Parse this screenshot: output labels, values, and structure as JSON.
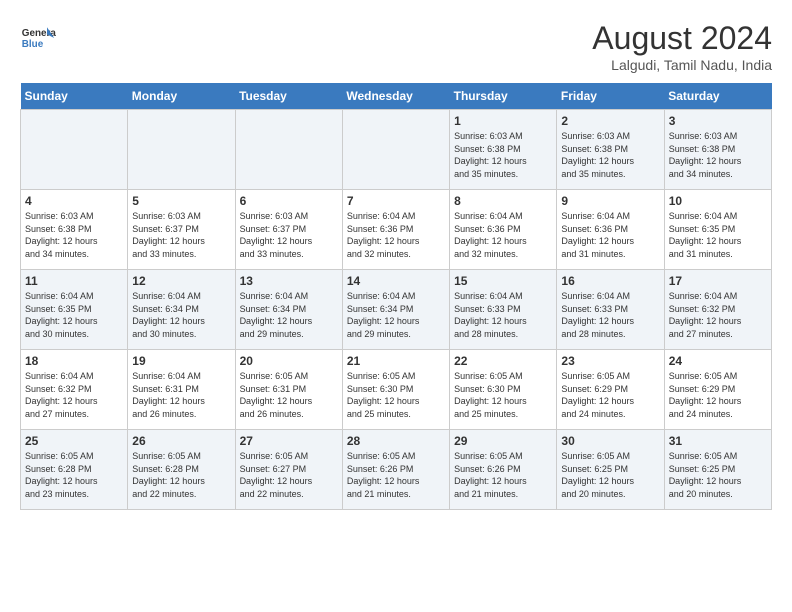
{
  "header": {
    "logo_line1": "General",
    "logo_line2": "Blue",
    "month_year": "August 2024",
    "location": "Lalgudi, Tamil Nadu, India"
  },
  "weekdays": [
    "Sunday",
    "Monday",
    "Tuesday",
    "Wednesday",
    "Thursday",
    "Friday",
    "Saturday"
  ],
  "weeks": [
    [
      {
        "day": "",
        "info": ""
      },
      {
        "day": "",
        "info": ""
      },
      {
        "day": "",
        "info": ""
      },
      {
        "day": "",
        "info": ""
      },
      {
        "day": "1",
        "info": "Sunrise: 6:03 AM\nSunset: 6:38 PM\nDaylight: 12 hours\nand 35 minutes."
      },
      {
        "day": "2",
        "info": "Sunrise: 6:03 AM\nSunset: 6:38 PM\nDaylight: 12 hours\nand 35 minutes."
      },
      {
        "day": "3",
        "info": "Sunrise: 6:03 AM\nSunset: 6:38 PM\nDaylight: 12 hours\nand 34 minutes."
      }
    ],
    [
      {
        "day": "4",
        "info": "Sunrise: 6:03 AM\nSunset: 6:38 PM\nDaylight: 12 hours\nand 34 minutes."
      },
      {
        "day": "5",
        "info": "Sunrise: 6:03 AM\nSunset: 6:37 PM\nDaylight: 12 hours\nand 33 minutes."
      },
      {
        "day": "6",
        "info": "Sunrise: 6:03 AM\nSunset: 6:37 PM\nDaylight: 12 hours\nand 33 minutes."
      },
      {
        "day": "7",
        "info": "Sunrise: 6:04 AM\nSunset: 6:36 PM\nDaylight: 12 hours\nand 32 minutes."
      },
      {
        "day": "8",
        "info": "Sunrise: 6:04 AM\nSunset: 6:36 PM\nDaylight: 12 hours\nand 32 minutes."
      },
      {
        "day": "9",
        "info": "Sunrise: 6:04 AM\nSunset: 6:36 PM\nDaylight: 12 hours\nand 31 minutes."
      },
      {
        "day": "10",
        "info": "Sunrise: 6:04 AM\nSunset: 6:35 PM\nDaylight: 12 hours\nand 31 minutes."
      }
    ],
    [
      {
        "day": "11",
        "info": "Sunrise: 6:04 AM\nSunset: 6:35 PM\nDaylight: 12 hours\nand 30 minutes."
      },
      {
        "day": "12",
        "info": "Sunrise: 6:04 AM\nSunset: 6:34 PM\nDaylight: 12 hours\nand 30 minutes."
      },
      {
        "day": "13",
        "info": "Sunrise: 6:04 AM\nSunset: 6:34 PM\nDaylight: 12 hours\nand 29 minutes."
      },
      {
        "day": "14",
        "info": "Sunrise: 6:04 AM\nSunset: 6:34 PM\nDaylight: 12 hours\nand 29 minutes."
      },
      {
        "day": "15",
        "info": "Sunrise: 6:04 AM\nSunset: 6:33 PM\nDaylight: 12 hours\nand 28 minutes."
      },
      {
        "day": "16",
        "info": "Sunrise: 6:04 AM\nSunset: 6:33 PM\nDaylight: 12 hours\nand 28 minutes."
      },
      {
        "day": "17",
        "info": "Sunrise: 6:04 AM\nSunset: 6:32 PM\nDaylight: 12 hours\nand 27 minutes."
      }
    ],
    [
      {
        "day": "18",
        "info": "Sunrise: 6:04 AM\nSunset: 6:32 PM\nDaylight: 12 hours\nand 27 minutes."
      },
      {
        "day": "19",
        "info": "Sunrise: 6:04 AM\nSunset: 6:31 PM\nDaylight: 12 hours\nand 26 minutes."
      },
      {
        "day": "20",
        "info": "Sunrise: 6:05 AM\nSunset: 6:31 PM\nDaylight: 12 hours\nand 26 minutes."
      },
      {
        "day": "21",
        "info": "Sunrise: 6:05 AM\nSunset: 6:30 PM\nDaylight: 12 hours\nand 25 minutes."
      },
      {
        "day": "22",
        "info": "Sunrise: 6:05 AM\nSunset: 6:30 PM\nDaylight: 12 hours\nand 25 minutes."
      },
      {
        "day": "23",
        "info": "Sunrise: 6:05 AM\nSunset: 6:29 PM\nDaylight: 12 hours\nand 24 minutes."
      },
      {
        "day": "24",
        "info": "Sunrise: 6:05 AM\nSunset: 6:29 PM\nDaylight: 12 hours\nand 24 minutes."
      }
    ],
    [
      {
        "day": "25",
        "info": "Sunrise: 6:05 AM\nSunset: 6:28 PM\nDaylight: 12 hours\nand 23 minutes."
      },
      {
        "day": "26",
        "info": "Sunrise: 6:05 AM\nSunset: 6:28 PM\nDaylight: 12 hours\nand 22 minutes."
      },
      {
        "day": "27",
        "info": "Sunrise: 6:05 AM\nSunset: 6:27 PM\nDaylight: 12 hours\nand 22 minutes."
      },
      {
        "day": "28",
        "info": "Sunrise: 6:05 AM\nSunset: 6:26 PM\nDaylight: 12 hours\nand 21 minutes."
      },
      {
        "day": "29",
        "info": "Sunrise: 6:05 AM\nSunset: 6:26 PM\nDaylight: 12 hours\nand 21 minutes."
      },
      {
        "day": "30",
        "info": "Sunrise: 6:05 AM\nSunset: 6:25 PM\nDaylight: 12 hours\nand 20 minutes."
      },
      {
        "day": "31",
        "info": "Sunrise: 6:05 AM\nSunset: 6:25 PM\nDaylight: 12 hours\nand 20 minutes."
      }
    ]
  ]
}
